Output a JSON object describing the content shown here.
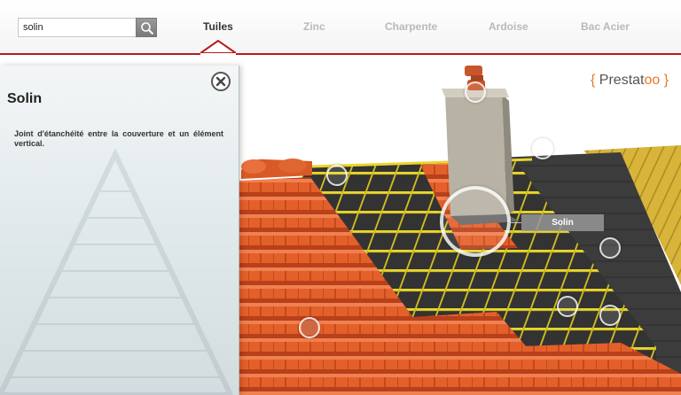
{
  "search": {
    "value": "solin"
  },
  "nav": {
    "tabs": [
      {
        "label": "Tuiles",
        "active": true
      },
      {
        "label": "Zinc",
        "active": false
      },
      {
        "label": "Charpente",
        "active": false
      },
      {
        "label": "Ardoise",
        "active": false
      },
      {
        "label": "Bac Acier",
        "active": false
      }
    ]
  },
  "panel": {
    "title": "Solin",
    "description": "Joint d'étanchéité entre la couverture et un élément vertical."
  },
  "hotspot_label": "Solin",
  "brand": {
    "brace_open": "{",
    "name_main": "Prestat",
    "name_accent": "oo",
    "brace_close": "}"
  },
  "colors": {
    "accent_red": "#b71b1b",
    "tile_orange": "#e4602a",
    "batten_yellow": "#e8d62a",
    "membrane_dark": "#3a3a3a",
    "brand_orange": "#e87722"
  },
  "icons": {
    "search": "magnifier-icon",
    "close": "close-circle-icon"
  }
}
